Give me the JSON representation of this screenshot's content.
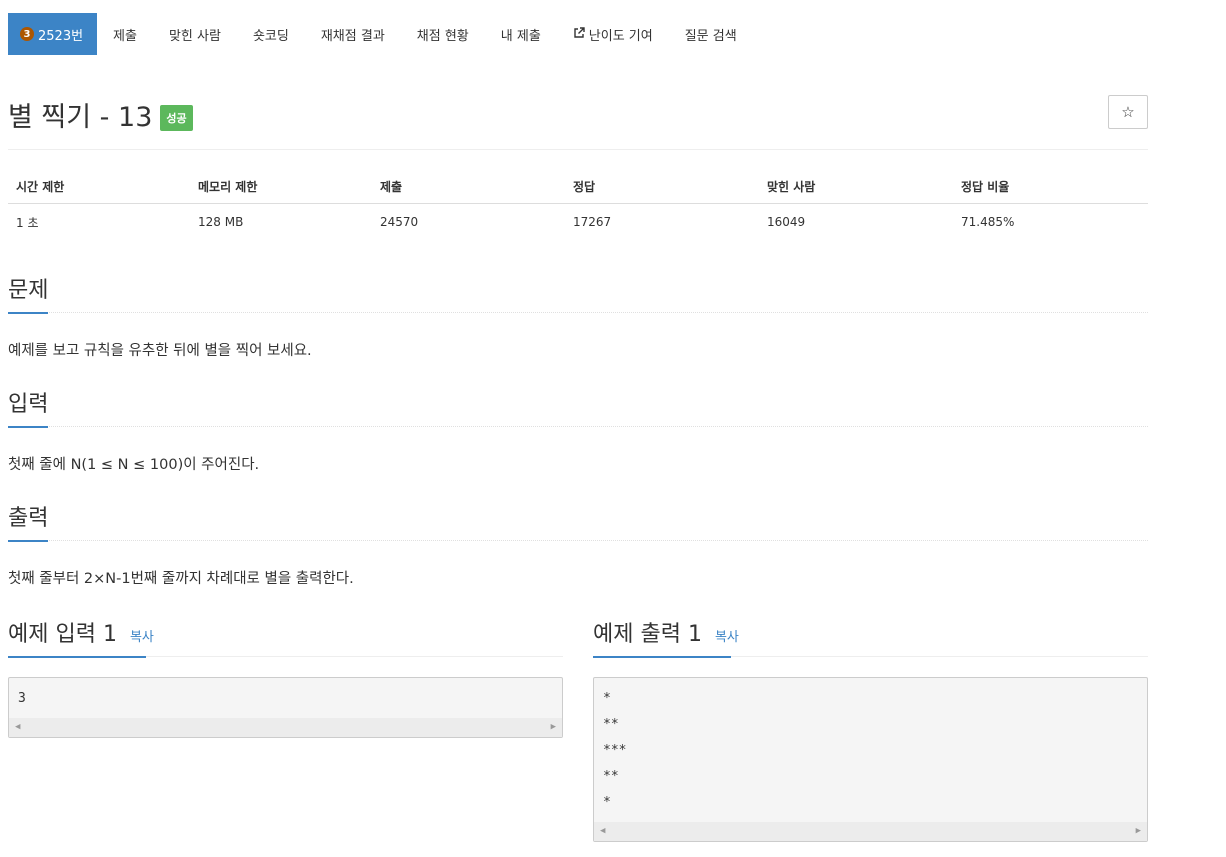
{
  "nav": {
    "tabs": [
      {
        "label": "2523번",
        "tier": "3",
        "active": true
      },
      {
        "label": "제출"
      },
      {
        "label": "맞힌 사람"
      },
      {
        "label": "숏코딩"
      },
      {
        "label": "재채점 결과"
      },
      {
        "label": "채점 현황"
      },
      {
        "label": "내 제출"
      },
      {
        "label": "난이도 기여",
        "icon": "external-link-icon"
      },
      {
        "label": "질문 검색"
      }
    ]
  },
  "problem": {
    "title": "별 찍기 - 13",
    "status": "성공",
    "star_icon": "☆"
  },
  "info_table": {
    "headers": [
      "시간 제한",
      "메모리 제한",
      "제출",
      "정답",
      "맞힌 사람",
      "정답 비율"
    ],
    "values": [
      "1 초",
      "128 MB",
      "24570",
      "17267",
      "16049",
      "71.485%"
    ]
  },
  "sections": {
    "problem": {
      "heading": "문제",
      "text": "예제를 보고 규칙을 유추한 뒤에 별을 찍어 보세요."
    },
    "input": {
      "heading": "입력",
      "text": "첫째 줄에 N(1 ≤ N ≤ 100)이 주어진다."
    },
    "output": {
      "heading": "출력",
      "text": "첫째 줄부터 2×N-1번째 줄까지 차례대로 별을 출력한다."
    }
  },
  "samples": {
    "input": {
      "heading": "예제 입력 1",
      "copy": "복사",
      "lines": [
        "3"
      ]
    },
    "output": {
      "heading": "예제 출력 1",
      "copy": "복사",
      "lines": [
        "*",
        "**",
        "***",
        "**",
        "*"
      ]
    }
  },
  "colors": {
    "accent": "#3c84c6",
    "success": "#5cb85c",
    "tier_bronze": "#ad5600"
  }
}
